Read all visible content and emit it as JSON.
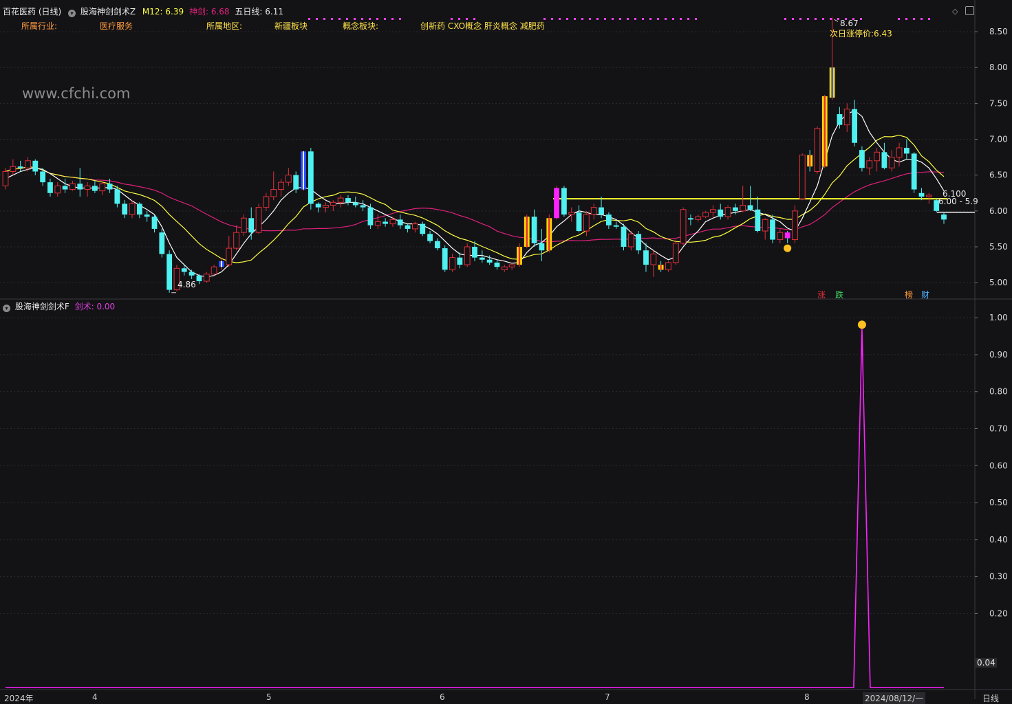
{
  "header": {
    "stock_name": "百花医药 (日线)",
    "indicator_main_name": "股海神剑剑术Z",
    "m12_label": "M12:",
    "m12_value": "6.39",
    "shenjian_label": "神剑:",
    "shenjian_value": "6.68",
    "wuri_label": "五日线:",
    "wuri_value": "6.11"
  },
  "info_row": {
    "industry_label": "所属行业:",
    "industry_value": "医疗服务",
    "region_label": "所属地区:",
    "region_value": "新疆板块",
    "concept_label": "概念板块:",
    "concept_value": "创新药 CXO概念 肝炎概念 减肥药"
  },
  "watermark": "www.cfchi.com",
  "annotations": {
    "high_label": "8.67",
    "low_label": "4.86",
    "next_limit_label": "次日涨停价:",
    "next_limit_value": "6.43",
    "right_price_1": "6.100",
    "right_price_2": "6.00 - 5.9",
    "tag_up": "涨",
    "tag_down": "跌",
    "tag_list": "榜",
    "tag_fin": "财"
  },
  "lower_header": {
    "indicator_sub_name": "股海神剑剑术F",
    "jianshu_label": "剑术:",
    "jianshu_value": "0.00"
  },
  "x_axis": {
    "labels": [
      "2024年",
      "4",
      "5",
      "6",
      "7",
      "8",
      "2024/08/12/一"
    ],
    "period": "日线"
  },
  "colors": {
    "background": "#131316",
    "up": "#e0303a",
    "down": "#4ff0f0",
    "ma5": "#ffffff",
    "m12": "#ffff40",
    "shenjian": "#e0207a",
    "signal": "#ff22ff",
    "yellow_bar": "#ffd700",
    "blue_bar": "#2850ff",
    "hline": "#ffff30"
  },
  "chart_data": [
    {
      "type": "candlestick",
      "title": "百花医药 (日线)",
      "ylim": [
        4.8,
        8.75
      ],
      "y_ticks": [
        "8.50",
        "8.00",
        "7.50",
        "7.00",
        "6.50",
        "6.00",
        "5.50",
        "5.00"
      ],
      "ohlc": [
        [
          6.35,
          6.6,
          6.3,
          6.55
        ],
        [
          6.55,
          6.72,
          6.5,
          6.62
        ],
        [
          6.62,
          6.7,
          6.55,
          6.6
        ],
        [
          6.6,
          6.75,
          6.55,
          6.7
        ],
        [
          6.7,
          6.72,
          6.5,
          6.55
        ],
        [
          6.55,
          6.6,
          6.35,
          6.4
        ],
        [
          6.4,
          6.45,
          6.2,
          6.25
        ],
        [
          6.25,
          6.4,
          6.2,
          6.35
        ],
        [
          6.35,
          6.45,
          6.25,
          6.3
        ],
        [
          6.3,
          6.42,
          6.28,
          6.38
        ],
        [
          6.38,
          6.6,
          6.2,
          6.3
        ],
        [
          6.3,
          6.4,
          6.2,
          6.35
        ],
        [
          6.35,
          6.42,
          6.25,
          6.28
        ],
        [
          6.28,
          6.4,
          6.22,
          6.38
        ],
        [
          6.38,
          6.45,
          6.25,
          6.3
        ],
        [
          6.3,
          6.35,
          6.05,
          6.1
        ],
        [
          6.1,
          6.15,
          5.9,
          5.95
        ],
        [
          5.95,
          6.15,
          5.9,
          6.1
        ],
        [
          6.1,
          6.12,
          5.9,
          5.95
        ],
        [
          5.95,
          6.0,
          5.85,
          5.92
        ],
        [
          5.92,
          5.95,
          5.7,
          5.75
        ],
        [
          5.7,
          5.75,
          5.35,
          5.4
        ],
        [
          5.4,
          5.45,
          4.86,
          4.9
        ],
        [
          4.9,
          5.25,
          4.88,
          5.2
        ],
        [
          5.2,
          5.25,
          5.1,
          5.15
        ],
        [
          5.15,
          5.18,
          5.05,
          5.1
        ],
        [
          5.1,
          5.12,
          4.98,
          5.02
        ],
        [
          5.02,
          5.15,
          5.0,
          5.12
        ],
        [
          5.12,
          5.25,
          5.1,
          5.22
        ],
        [
          5.22,
          5.35,
          5.18,
          5.3
        ],
        [
          5.25,
          5.65,
          5.22,
          5.48
        ],
        [
          5.48,
          5.8,
          5.45,
          5.7
        ],
        [
          5.7,
          5.95,
          5.65,
          5.9
        ],
        [
          5.9,
          6.05,
          5.6,
          5.7
        ],
        [
          5.7,
          6.1,
          5.68,
          6.05
        ],
        [
          6.05,
          6.25,
          6.0,
          6.2
        ],
        [
          6.2,
          6.55,
          6.15,
          6.3
        ],
        [
          6.3,
          6.45,
          6.2,
          6.4
        ],
        [
          6.4,
          6.6,
          6.35,
          6.5
        ],
        [
          6.5,
          6.55,
          6.25,
          6.3
        ],
        [
          6.3,
          6.84,
          6.28,
          6.83
        ],
        [
          6.83,
          6.88,
          6.02,
          6.1
        ],
        [
          6.1,
          6.12,
          5.98,
          6.05
        ],
        [
          6.05,
          6.12,
          5.98,
          6.08
        ],
        [
          6.08,
          6.15,
          6.0,
          6.12
        ],
        [
          6.12,
          6.22,
          6.05,
          6.18
        ],
        [
          6.18,
          6.22,
          6.08,
          6.12
        ],
        [
          6.12,
          6.2,
          6.05,
          6.08
        ],
        [
          6.08,
          6.15,
          6.0,
          6.05
        ],
        [
          6.05,
          6.1,
          5.75,
          5.8
        ],
        [
          5.8,
          5.95,
          5.75,
          5.85
        ],
        [
          5.85,
          5.9,
          5.78,
          5.82
        ],
        [
          5.82,
          5.92,
          5.78,
          5.88
        ],
        [
          5.88,
          5.95,
          5.75,
          5.8
        ],
        [
          5.8,
          5.82,
          5.7,
          5.75
        ],
        [
          5.75,
          5.85,
          5.7,
          5.82
        ],
        [
          5.82,
          5.85,
          5.65,
          5.68
        ],
        [
          5.68,
          5.72,
          5.55,
          5.58
        ],
        [
          5.58,
          5.62,
          5.45,
          5.48
        ],
        [
          5.48,
          5.52,
          5.15,
          5.18
        ],
        [
          5.18,
          5.4,
          5.15,
          5.35
        ],
        [
          5.35,
          5.42,
          5.2,
          5.25
        ],
        [
          5.25,
          5.55,
          5.22,
          5.5
        ],
        [
          5.5,
          5.58,
          5.3,
          5.35
        ],
        [
          5.35,
          5.45,
          5.28,
          5.32
        ],
        [
          5.32,
          5.38,
          5.25,
          5.28
        ],
        [
          5.28,
          5.32,
          5.18,
          5.22
        ],
        [
          5.18,
          5.25,
          5.15,
          5.22
        ],
        [
          5.22,
          5.28,
          5.18,
          5.25
        ],
        [
          5.25,
          5.55,
          5.22,
          5.5
        ],
        [
          5.5,
          5.95,
          5.48,
          5.92
        ],
        [
          5.92,
          6.02,
          5.5,
          5.55
        ],
        [
          5.55,
          5.75,
          5.3,
          5.45
        ],
        [
          5.45,
          5.95,
          5.42,
          5.9
        ],
        [
          5.9,
          6.35,
          5.88,
          6.32
        ],
        [
          6.32,
          6.35,
          5.92,
          5.95
        ],
        [
          5.95,
          6.05,
          5.85,
          5.98
        ],
        [
          5.98,
          6.08,
          5.7,
          5.72
        ],
        [
          5.72,
          6.0,
          5.65,
          5.95
        ],
        [
          5.95,
          6.1,
          5.88,
          6.05
        ],
        [
          6.05,
          6.2,
          5.9,
          5.95
        ],
        [
          5.95,
          5.98,
          5.75,
          5.8
        ],
        [
          5.8,
          5.85,
          5.75,
          5.78
        ],
        [
          5.78,
          5.82,
          5.45,
          5.5
        ],
        [
          5.5,
          5.72,
          5.45,
          5.68
        ],
        [
          5.68,
          5.72,
          5.4,
          5.45
        ],
        [
          5.45,
          5.55,
          5.15,
          5.25
        ],
        [
          5.25,
          5.45,
          5.08,
          5.4
        ],
        [
          5.25,
          5.3,
          5.15,
          5.18
        ],
        [
          5.18,
          5.3,
          5.15,
          5.28
        ],
        [
          5.28,
          5.6,
          5.25,
          5.55
        ],
        [
          5.55,
          6.05,
          5.52,
          6.02
        ],
        [
          5.9,
          5.95,
          5.8,
          5.88
        ],
        [
          5.88,
          5.95,
          5.85,
          5.92
        ],
        [
          5.92,
          6.0,
          5.9,
          5.98
        ],
        [
          5.98,
          6.08,
          5.9,
          6.02
        ],
        [
          6.02,
          6.1,
          5.88,
          5.92
        ],
        [
          5.92,
          6.08,
          5.88,
          6.05
        ],
        [
          6.05,
          6.1,
          5.95,
          6.0
        ],
        [
          6.0,
          6.35,
          5.98,
          6.08
        ],
        [
          6.08,
          6.35,
          6.0,
          6.02
        ],
        [
          6.02,
          6.2,
          5.7,
          5.72
        ],
        [
          5.72,
          5.9,
          5.6,
          5.88
        ],
        [
          5.88,
          5.95,
          5.55,
          5.6
        ],
        [
          5.6,
          5.75,
          5.55,
          5.7
        ],
        [
          5.7,
          5.72,
          5.55,
          5.62
        ],
        [
          5.6,
          6.08,
          5.55,
          6.0
        ],
        [
          6.17,
          6.8,
          6.15,
          6.78
        ],
        [
          6.78,
          6.85,
          6.55,
          6.62
        ],
        [
          6.55,
          7.18,
          6.52,
          7.15
        ],
        [
          6.62,
          7.62,
          6.6,
          7.6
        ],
        [
          7.58,
          8.7,
          7.55,
          8.0
        ],
        [
          7.35,
          7.45,
          7.15,
          7.2
        ],
        [
          7.2,
          7.5,
          7.1,
          7.42
        ],
        [
          7.42,
          7.55,
          6.9,
          6.95
        ],
        [
          6.85,
          6.9,
          6.55,
          6.6
        ],
        [
          6.6,
          6.75,
          6.5,
          6.7
        ],
        [
          6.7,
          6.88,
          6.55,
          6.82
        ],
        [
          6.82,
          6.95,
          6.58,
          6.6
        ],
        [
          6.6,
          6.85,
          6.55,
          6.75
        ],
        [
          6.75,
          6.95,
          6.62,
          6.88
        ],
        [
          6.88,
          7.0,
          6.72,
          6.8
        ],
        [
          6.8,
          6.82,
          6.25,
          6.3
        ],
        [
          6.25,
          6.32,
          6.15,
          6.2
        ],
        [
          6.2,
          6.25,
          6.1,
          6.22
        ],
        [
          6.15,
          6.18,
          5.98,
          6.0
        ],
        [
          5.95,
          5.98,
          5.82,
          5.88
        ]
      ],
      "ma5": [
        6.45,
        6.5,
        6.55,
        6.58,
        6.6,
        6.58,
        6.52,
        6.45,
        6.38,
        6.34,
        6.32,
        6.32,
        6.32,
        6.32,
        6.33,
        6.3,
        6.22,
        6.14,
        6.08,
        6.02,
        5.95,
        5.78,
        5.55,
        5.35,
        5.25,
        5.15,
        5.1,
        5.08,
        5.1,
        5.15,
        5.25,
        5.4,
        5.55,
        5.68,
        5.78,
        5.88,
        6.0,
        6.15,
        6.25,
        6.32,
        6.33,
        6.3,
        6.22,
        6.15,
        6.1,
        6.1,
        6.12,
        6.12,
        6.1,
        6.05,
        6.0,
        5.95,
        5.9,
        5.85,
        5.82,
        5.82,
        5.8,
        5.75,
        5.68,
        5.58,
        5.48,
        5.4,
        5.38,
        5.38,
        5.38,
        5.35,
        5.32,
        5.3,
        5.27,
        5.28,
        5.42,
        5.52,
        5.56,
        5.65,
        5.78,
        5.86,
        5.95,
        6.0,
        5.98,
        5.95,
        5.95,
        5.92,
        5.88,
        5.8,
        5.7,
        5.62,
        5.52,
        5.45,
        5.38,
        5.32,
        5.36,
        5.5,
        5.62,
        5.72,
        5.85,
        5.9,
        5.94,
        5.96,
        5.98,
        6.0,
        6.02,
        5.98,
        5.95,
        5.9,
        5.85,
        5.76,
        5.72,
        5.9,
        6.12,
        6.35,
        6.7,
        7.05,
        7.25,
        7.35,
        7.4,
        7.32,
        7.1,
        6.95,
        6.82,
        6.72,
        6.68,
        6.72,
        6.72,
        6.68,
        6.6,
        6.45,
        6.28
      ]
    },
    {
      "type": "line",
      "series": [
        {
          "name": "剑术",
          "values_by_index": {
            "default": 0.0,
            "spike_index": 115,
            "spike_value": 0.97
          }
        }
      ],
      "ylim": [
        0.0,
        1.03
      ],
      "y_ticks": [
        "1.00",
        "0.90",
        "0.80",
        "0.70",
        "0.60",
        "0.50",
        "0.40",
        "0.30",
        "0.20"
      ],
      "current_value_label": "0.04"
    }
  ]
}
